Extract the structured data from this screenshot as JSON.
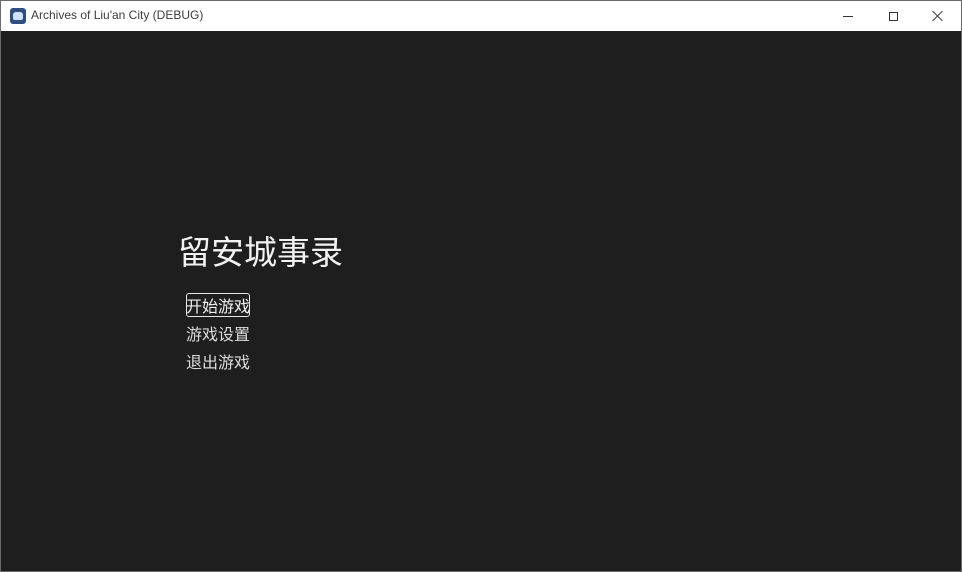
{
  "window": {
    "title": "Archives of Liu'an City (DEBUG)",
    "icon": "godot-engine-icon"
  },
  "main_menu": {
    "title": "留安城事录",
    "buttons": [
      {
        "label": "开始游戏",
        "focused": true
      },
      {
        "label": "游戏设置",
        "focused": false
      },
      {
        "label": "退出游戏",
        "focused": false
      }
    ]
  },
  "colors": {
    "background": "#1e1e1e",
    "text": "#f2f2f2",
    "titlebar": "#ffffff"
  }
}
